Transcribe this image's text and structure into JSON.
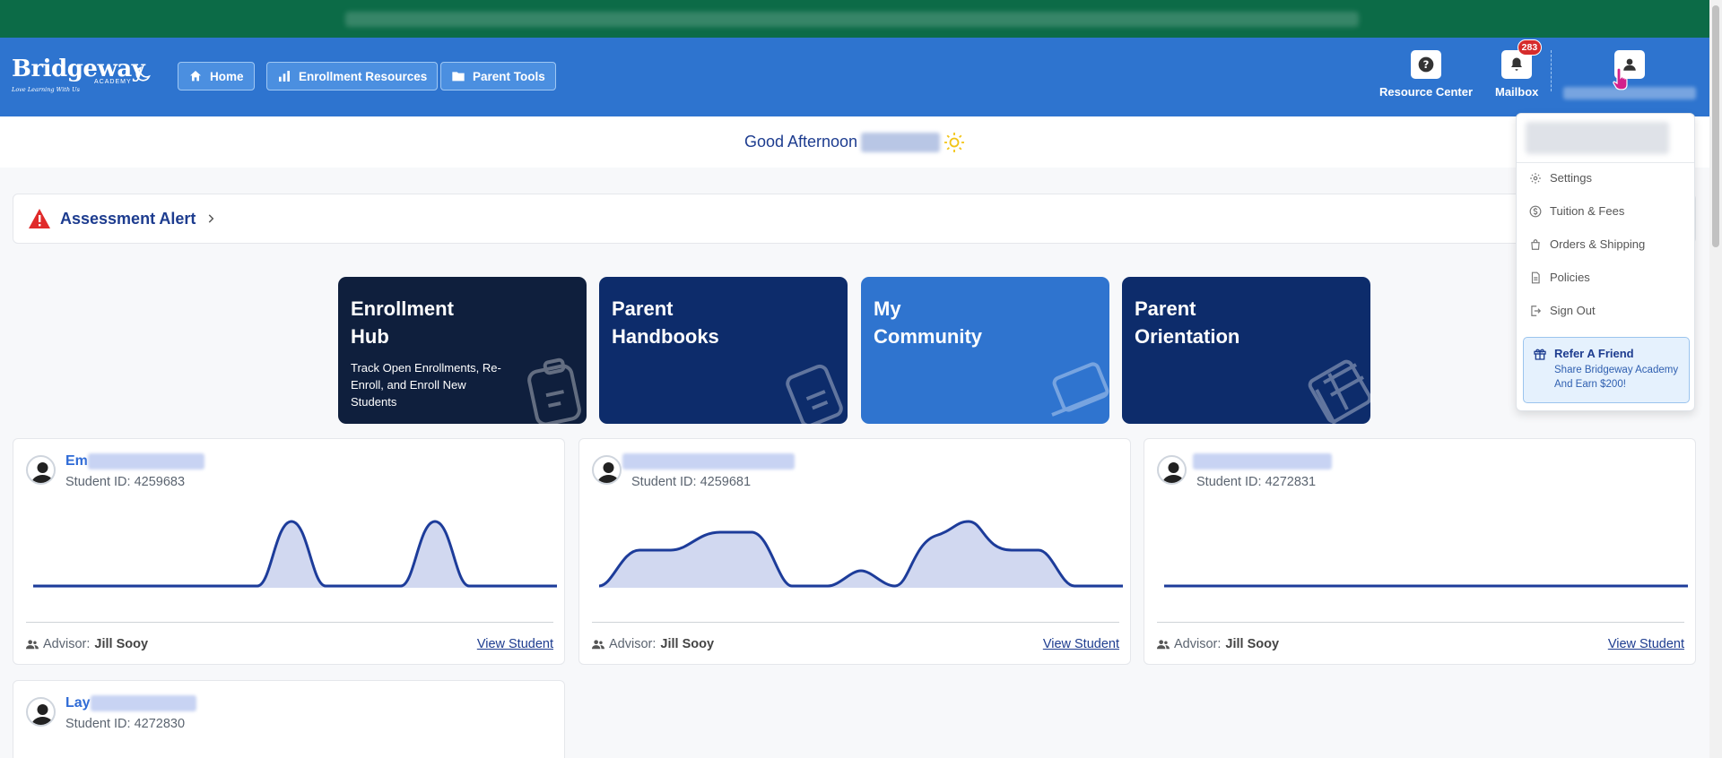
{
  "brand": {
    "name": "Bridgeway",
    "sub": "ACADEMY",
    "tagline": "Love Learning With Us"
  },
  "nav": {
    "home": "Home",
    "enrollment": "Enrollment Resources",
    "parent_tools": "Parent Tools"
  },
  "tools": {
    "resource_center": "Resource Center",
    "mailbox": "Mailbox",
    "mail_count": "283"
  },
  "greeting": {
    "text": "Good Afternoon"
  },
  "alert": {
    "title": "Assessment Alert"
  },
  "tiles": [
    {
      "line1": "Enrollment",
      "line2": "Hub",
      "desc": "Track Open Enrollments, Re-Enroll, and Enroll New Students",
      "color": "#0f1f3d"
    },
    {
      "line1": "Parent",
      "line2": "Handbooks",
      "desc": "",
      "color": "#0d2c6b"
    },
    {
      "line1": "My",
      "line2": "Community",
      "desc": "",
      "color": "#2f74cf"
    },
    {
      "line1": "Parent",
      "line2": "Orientation",
      "desc": "",
      "color": "#0d2c6b"
    }
  ],
  "students": [
    {
      "name_prefix": "Em",
      "id_text": "Student ID: 4259683",
      "advisor_label": "Advisor:",
      "advisor": "Jill Sooy",
      "link": "View Student"
    },
    {
      "name_prefix": "",
      "id_text": "Student ID: 4259681",
      "advisor_label": "Advisor:",
      "advisor": "Jill Sooy",
      "link": "View Student"
    },
    {
      "name_prefix": "",
      "id_text": "Student ID: 4272831",
      "advisor_label": "Advisor:",
      "advisor": "Jill Sooy",
      "link": "View Student"
    },
    {
      "name_prefix": "Lay",
      "id_text": "Student ID: 4272830"
    }
  ],
  "dropdown": {
    "settings": "Settings",
    "tuition": "Tuition & Fees",
    "orders": "Orders & Shipping",
    "policies": "Policies",
    "signout": "Sign Out",
    "refer_title": "Refer A Friend",
    "refer_sub": "Share Bridgeway Academy And Earn $200!"
  },
  "colors": {
    "banner": "#0c6b47",
    "topbar": "#2e74cf",
    "accent": "#1d3c8f",
    "alert_red": "#e02a2a"
  }
}
